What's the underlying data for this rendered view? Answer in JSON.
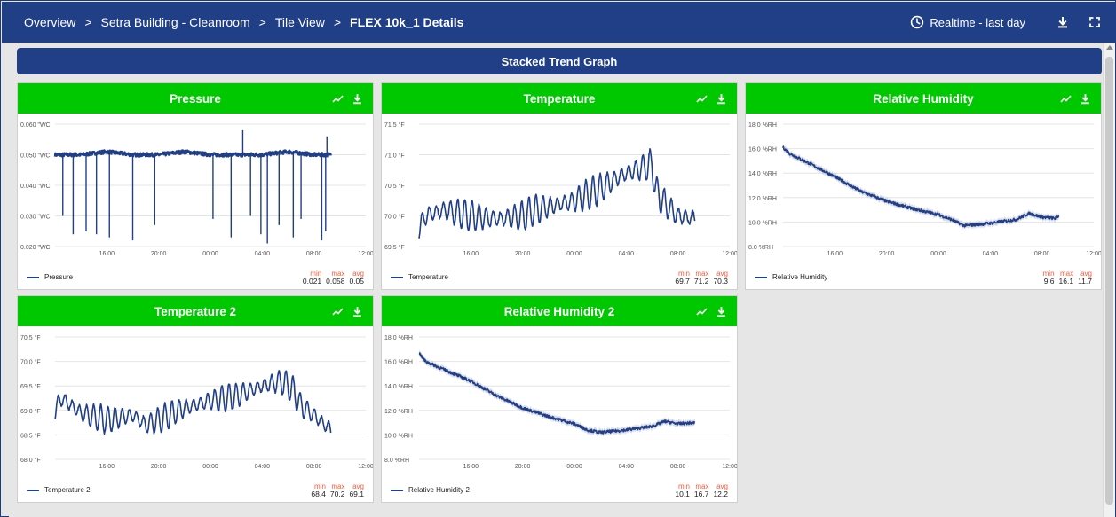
{
  "nav": {
    "breadcrumbs": [
      "Overview",
      "Setra Building - Cleanroom",
      "Tile View"
    ],
    "separator": ">",
    "current": "FLEX 10k_1 Details",
    "time_range": "Realtime - last day"
  },
  "banner": {
    "title": "Stacked Trend Graph"
  },
  "colors": {
    "nav": "#213f87",
    "header_green": "#00c800",
    "line": "#213f87",
    "stat_label": "#ff5a36"
  },
  "icons": {
    "clock": "clock-icon",
    "download": "download-icon",
    "fullscreen": "fullscreen-icon",
    "trend": "trend-icon"
  },
  "panels": [
    {
      "title": "Pressure",
      "legend": "Pressure",
      "stats": [
        {
          "label": "min",
          "value": "0.021"
        },
        {
          "label": "max",
          "value": "0.058"
        },
        {
          "label": "avg",
          "value": "0.05"
        }
      ]
    },
    {
      "title": "Temperature",
      "legend": "Temperature",
      "stats": [
        {
          "label": "min",
          "value": "69.7"
        },
        {
          "label": "max",
          "value": "71.2"
        },
        {
          "label": "avg",
          "value": "70.3"
        }
      ]
    },
    {
      "title": "Relative Humidity",
      "legend": "Relative Humidity",
      "stats": [
        {
          "label": "min",
          "value": "9.6"
        },
        {
          "label": "max",
          "value": "16.1"
        },
        {
          "label": "avg",
          "value": "11.7"
        }
      ]
    },
    {
      "title": "Temperature 2",
      "legend": "Temperature 2",
      "stats": [
        {
          "label": "min",
          "value": "68.4"
        },
        {
          "label": "max",
          "value": "70.2"
        },
        {
          "label": "avg",
          "value": "69.1"
        }
      ]
    },
    {
      "title": "Relative Humidity 2",
      "legend": "Relative Humidity 2",
      "stats": [
        {
          "label": "min",
          "value": "10.1"
        },
        {
          "label": "max",
          "value": "16.7"
        },
        {
          "label": "avg",
          "value": "12.2"
        }
      ]
    }
  ],
  "chart_data": [
    {
      "type": "line",
      "series": [
        {
          "name": "Pressure",
          "x": [
            12.0,
            14.0,
            16.0,
            18.0,
            20.0,
            22.0,
            24.0,
            26.0,
            28.0,
            30.0,
            32.0,
            33.0,
            33.3
          ],
          "values": [
            0.05,
            0.05,
            0.051,
            0.05,
            0.05,
            0.051,
            0.05,
            0.05,
            0.05,
            0.051,
            0.05,
            0.05,
            0.05
          ]
        }
      ],
      "x_unit": "hours",
      "xlim": [
        12.0,
        36.0
      ],
      "ylim": [
        0.02,
        0.06
      ],
      "y_ticks": [
        "0.060 \"WC",
        "0.050 \"WC",
        "0.040 \"WC",
        "0.030 \"WC",
        "0.020 \"WC"
      ],
      "x_ticks": [
        "16:00",
        "20:00",
        "00:00",
        "04:00",
        "08:00",
        "12:00"
      ],
      "drops": [
        {
          "x": 12.6,
          "y": 0.03
        },
        {
          "x": 13.4,
          "y": 0.024
        },
        {
          "x": 14.4,
          "y": 0.025
        },
        {
          "x": 15.2,
          "y": 0.024
        },
        {
          "x": 16.2,
          "y": 0.023
        },
        {
          "x": 18.0,
          "y": 0.022
        },
        {
          "x": 19.7,
          "y": 0.027
        },
        {
          "x": 24.2,
          "y": 0.029
        },
        {
          "x": 25.6,
          "y": 0.023
        },
        {
          "x": 27.1,
          "y": 0.03
        },
        {
          "x": 27.9,
          "y": 0.024
        },
        {
          "x": 28.4,
          "y": 0.021
        },
        {
          "x": 29.3,
          "y": 0.027
        },
        {
          "x": 30.4,
          "y": 0.023
        },
        {
          "x": 31.0,
          "y": 0.029
        },
        {
          "x": 32.6,
          "y": 0.022
        },
        {
          "x": 32.9,
          "y": 0.025
        }
      ],
      "spikes": [
        {
          "x": 26.5,
          "y": 0.058
        },
        {
          "x": 33.0,
          "y": 0.056
        }
      ],
      "noise": 0.0006,
      "period_hours": 0.5
    },
    {
      "type": "line",
      "series": [
        {
          "name": "Temperature",
          "x": [
            12.0,
            12.5,
            14.0,
            16.0,
            18.0,
            20.0,
            21.0,
            22.0,
            24.0,
            26.0,
            28.0,
            29.5,
            30.0,
            30.3,
            31.0,
            32.0,
            33.3
          ],
          "values": [
            69.8,
            70.0,
            70.1,
            70.0,
            69.95,
            70.0,
            70.1,
            70.15,
            70.25,
            70.45,
            70.7,
            70.8,
            70.85,
            70.4,
            70.2,
            70.0,
            69.95
          ]
        }
      ],
      "x_unit": "hours",
      "xlim": [
        12.0,
        36.0
      ],
      "ylim": [
        69.5,
        71.5
      ],
      "y_ticks": [
        "71.5 °F",
        "71.0 °F",
        "70.5 °F",
        "70.0 °F",
        "69.5 °F"
      ],
      "x_ticks": [
        "16:00",
        "20:00",
        "00:00",
        "04:00",
        "08:00",
        "12:00"
      ],
      "amplitude": 0.26,
      "period_hours": 0.55,
      "noise": 0.02
    },
    {
      "type": "line",
      "series": [
        {
          "name": "Relative Humidity",
          "x": [
            12.0,
            12.5,
            14.0,
            16.0,
            18.0,
            20.0,
            22.0,
            24.0,
            25.0,
            26.0,
            28.0,
            30.0,
            31.0,
            32.0,
            33.0,
            33.3
          ],
          "values": [
            16.1,
            15.6,
            14.8,
            13.7,
            12.5,
            11.7,
            11.1,
            10.6,
            10.2,
            9.7,
            9.9,
            10.2,
            10.7,
            10.4,
            10.3,
            10.5
          ]
        }
      ],
      "x_unit": "hours",
      "xlim": [
        12.0,
        36.0
      ],
      "ylim": [
        8.0,
        18.0
      ],
      "y_ticks": [
        "18.0 %RH",
        "16.0 %RH",
        "14.0 %RH",
        "12.0 %RH",
        "10.0 %RH",
        "8.0 %RH"
      ],
      "x_ticks": [
        "16:00",
        "20:00",
        "00:00",
        "04:00",
        "08:00",
        "12:00"
      ],
      "band": 0.25,
      "noise": 0.12
    },
    {
      "type": "line",
      "series": [
        {
          "name": "Temperature 2",
          "x": [
            12.0,
            12.5,
            14.0,
            16.0,
            18.0,
            19.0,
            20.0,
            22.0,
            24.0,
            26.0,
            28.0,
            29.5,
            30.3,
            31.0,
            32.0,
            33.3
          ],
          "values": [
            69.0,
            69.25,
            68.95,
            68.8,
            68.9,
            68.7,
            68.8,
            69.05,
            69.2,
            69.3,
            69.5,
            69.6,
            69.45,
            69.1,
            68.9,
            68.6
          ]
        }
      ],
      "x_unit": "hours",
      "xlim": [
        12.0,
        36.0
      ],
      "ylim": [
        68.0,
        70.5
      ],
      "y_ticks": [
        "70.5 °F",
        "70.0 °F",
        "69.5 °F",
        "69.0 °F",
        "68.5 °F",
        "68.0 °F"
      ],
      "x_ticks": [
        "16:00",
        "20:00",
        "00:00",
        "04:00",
        "08:00",
        "12:00"
      ],
      "amplitude": 0.28,
      "period_hours": 0.55,
      "noise": 0.02
    },
    {
      "type": "line",
      "series": [
        {
          "name": "Relative Humidity 2",
          "x": [
            12.0,
            12.5,
            14.0,
            16.0,
            18.0,
            20.0,
            22.0,
            24.0,
            25.0,
            26.0,
            28.0,
            30.0,
            31.0,
            32.0,
            33.3
          ],
          "values": [
            16.7,
            16.0,
            15.3,
            14.4,
            13.2,
            12.2,
            11.5,
            10.9,
            10.4,
            10.2,
            10.4,
            10.7,
            11.1,
            10.9,
            11.0
          ]
        }
      ],
      "x_unit": "hours",
      "xlim": [
        12.0,
        36.0
      ],
      "ylim": [
        8.0,
        18.0
      ],
      "y_ticks": [
        "18.0 %RH",
        "16.0 %RH",
        "14.0 %RH",
        "12.0 %RH",
        "10.0 %RH",
        "8.0 %RH"
      ],
      "x_ticks": [
        "16:00",
        "20:00",
        "00:00",
        "04:00",
        "08:00",
        "12:00"
      ],
      "band": 0.25,
      "noise": 0.12
    }
  ]
}
